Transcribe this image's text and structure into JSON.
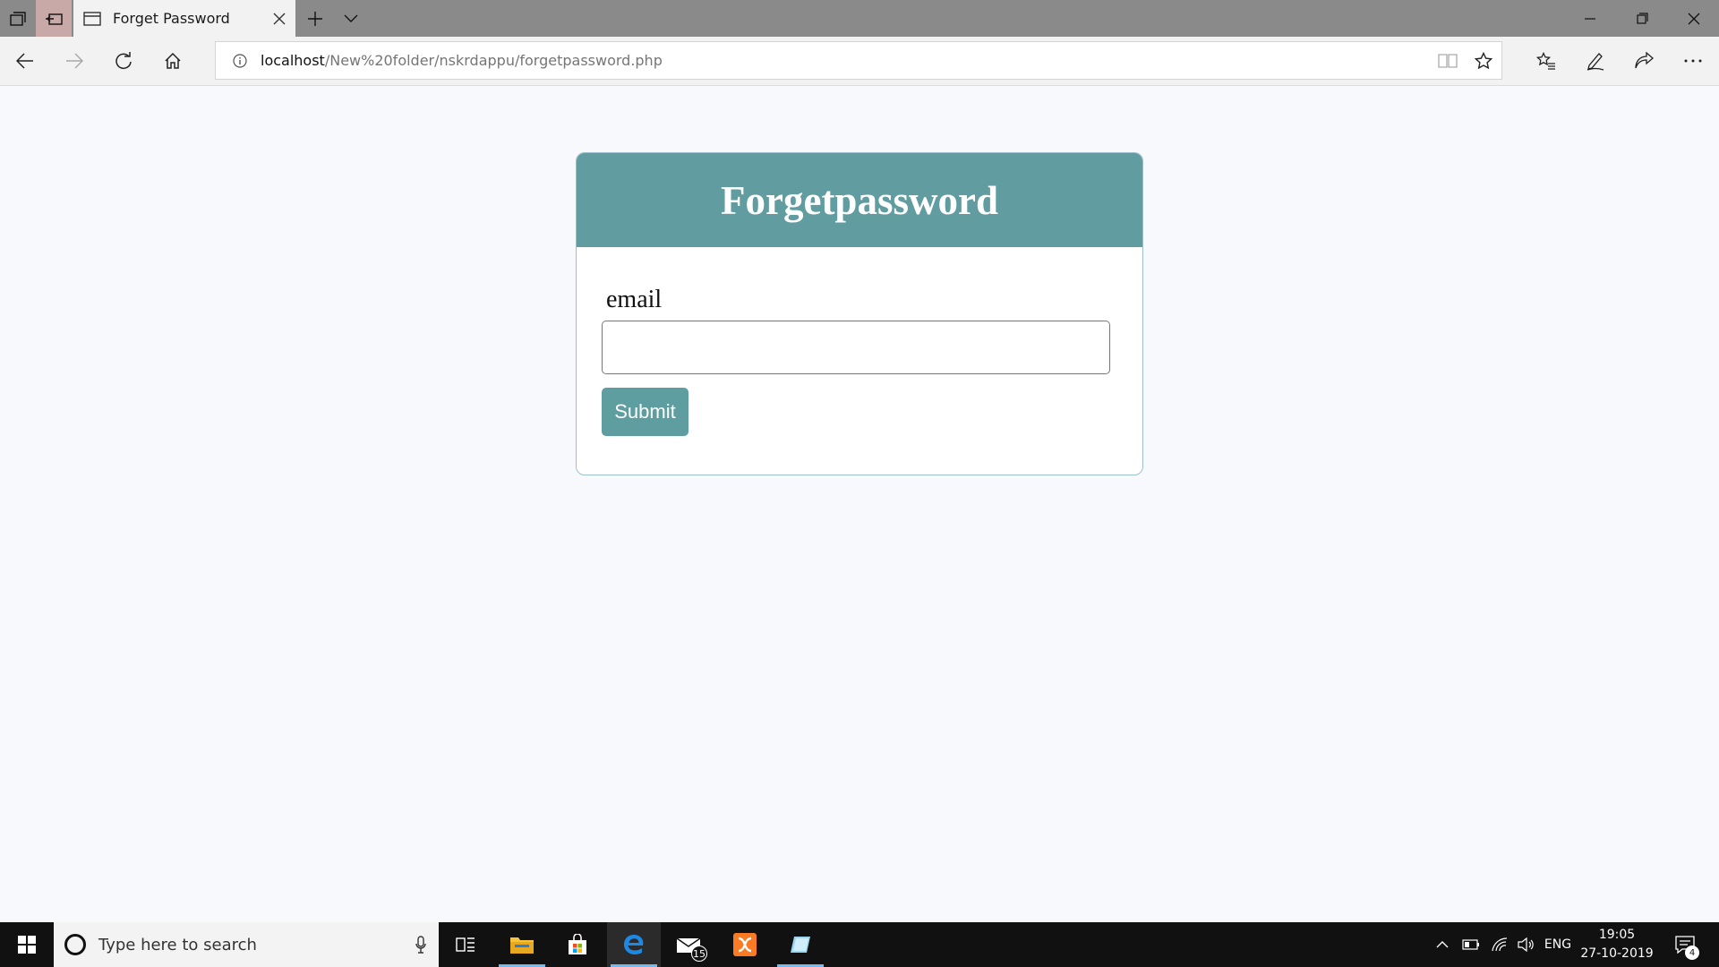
{
  "browser": {
    "tab": {
      "title": "Forget Password"
    },
    "address": {
      "host": "localhost",
      "path": "/New%20folder/nskrdappu/forgetpassword.php"
    }
  },
  "page": {
    "heading": "Forgetpassword",
    "email_label": "email",
    "email_value": "",
    "submit_label": "Submit"
  },
  "taskbar": {
    "search_placeholder": "Type here to search",
    "mail_badge": "15",
    "language": "ENG",
    "time": "19:05",
    "date": "27-10-2019",
    "notification_count": "4"
  },
  "colors": {
    "header_bg": "#619da0",
    "button_bg": "#5f9ea0",
    "page_bg": "#f8f9fc"
  }
}
